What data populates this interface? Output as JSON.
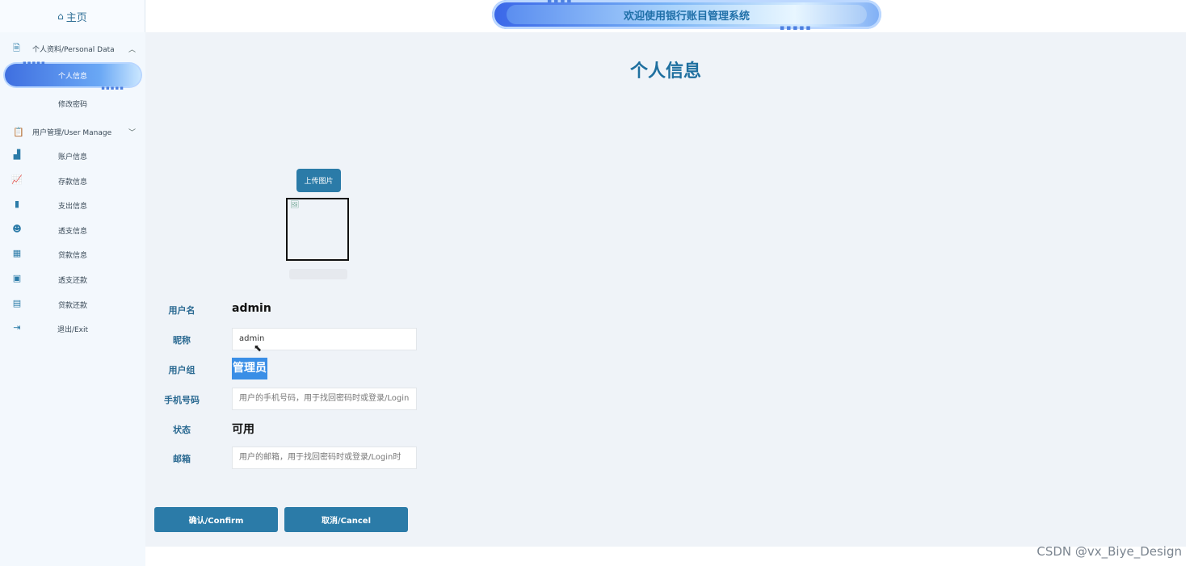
{
  "sidebar": {
    "home_label": "主页",
    "group_personal": "个人资料/Personal Data",
    "active_item": "个人信息",
    "change_password": "修改密码",
    "group_user": "用户管理/User Manage",
    "items": [
      {
        "label": "账户信息",
        "icon": "bar-chart-icon"
      },
      {
        "label": "存款信息",
        "icon": "line-chart-icon"
      },
      {
        "label": "支出信息",
        "icon": "bookmark-icon"
      },
      {
        "label": "透支信息",
        "icon": "user-badge-icon"
      },
      {
        "label": "贷款信息",
        "icon": "calendar-icon"
      },
      {
        "label": "透支还款",
        "icon": "calendar-check-icon"
      },
      {
        "label": "贷款还款",
        "icon": "book-icon"
      },
      {
        "label": "退出/Exit",
        "icon": "exit-icon"
      }
    ]
  },
  "header": {
    "banner_title": "欢迎使用银行账目管理系统"
  },
  "main": {
    "title": "个人信息",
    "upload_label": "上传图片",
    "form": {
      "username_label": "用户名",
      "username_value": "admin",
      "nickname_label": "昵称",
      "nickname_value": "admin",
      "group_label": "用户组",
      "group_value": "管理员",
      "phone_label": "手机号码",
      "phone_placeholder": "用户的手机号码，用于找回密码时或登录/Login",
      "status_label": "状态",
      "status_value": "可用",
      "email_label": "邮箱",
      "email_placeholder": "用户的邮箱，用于找回密码时或登录/Login时"
    },
    "confirm_label": "确认/Confirm",
    "cancel_label": "取消/Cancel"
  },
  "watermark": "CSDN @vx_Biye_Design",
  "colors": {
    "accent": "#2b7ba8",
    "title": "#1e6f9f",
    "highlight": "#3a8ee6",
    "content_bg": "#eff3f8",
    "sidebar_bg": "#f3f8fd"
  }
}
